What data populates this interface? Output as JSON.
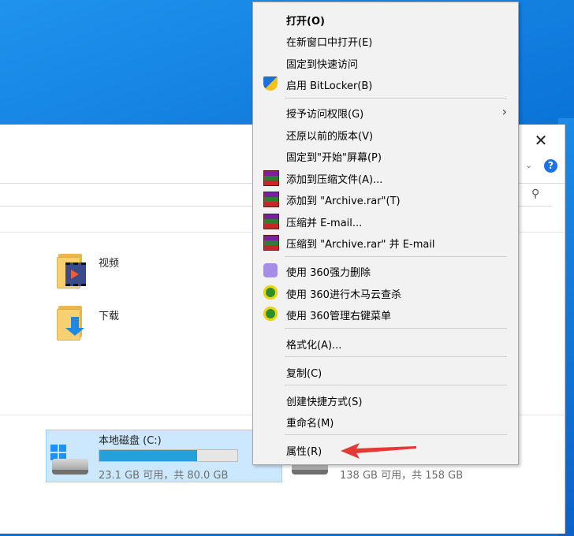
{
  "window": {
    "close_glyph": "✕",
    "help_glyph": "?",
    "chevron_glyph": "⌄",
    "search_glyph": "⚲"
  },
  "folders": [
    {
      "label": "视频",
      "icon": "video-folder-icon"
    },
    {
      "label": "下载",
      "icon": "downloads-folder-icon"
    }
  ],
  "drives": [
    {
      "name": "本地磁盘 (C:)",
      "size_text": "23.1 GB 可用，共 80.0 GB",
      "used_fraction": 0.71
    },
    {
      "size_text": "138 GB 可用，共 158 GB"
    }
  ],
  "context_menu": {
    "items": [
      {
        "label": "打开(O)",
        "bold": true
      },
      {
        "label": "在新窗口中打开(E)"
      },
      {
        "label": "固定到快速访问"
      },
      {
        "label": "启用 BitLocker(B)",
        "icon": "shield-icon"
      },
      {
        "label": "授予访问权限(G)",
        "submenu": true
      },
      {
        "label": "还原以前的版本(V)"
      },
      {
        "label": "固定到\"开始\"屏幕(P)"
      },
      {
        "label": "添加到压缩文件(A)...",
        "icon": "winrar-icon"
      },
      {
        "label": "添加到 \"Archive.rar\"(T)",
        "icon": "winrar-icon"
      },
      {
        "label": "压缩并 E-mail...",
        "icon": "winrar-icon"
      },
      {
        "label": "压缩到 \"Archive.rar\" 并 E-mail",
        "icon": "winrar-icon"
      },
      {
        "label": "使用 360强力删除",
        "icon": "360-shredder-icon"
      },
      {
        "label": "使用 360进行木马云查杀",
        "icon": "360-icon"
      },
      {
        "label": "使用 360管理右键菜单",
        "icon": "360-icon"
      },
      {
        "label": "格式化(A)..."
      },
      {
        "label": "复制(C)"
      },
      {
        "label": "创建快捷方式(S)"
      },
      {
        "label": "重命名(M)"
      },
      {
        "label": "属性(R)"
      }
    ],
    "submenu_glyph": "›"
  },
  "colors": {
    "accent_bar": "#26a0da",
    "annotation_arrow": "#e53935",
    "selection": "#cce8ff"
  }
}
